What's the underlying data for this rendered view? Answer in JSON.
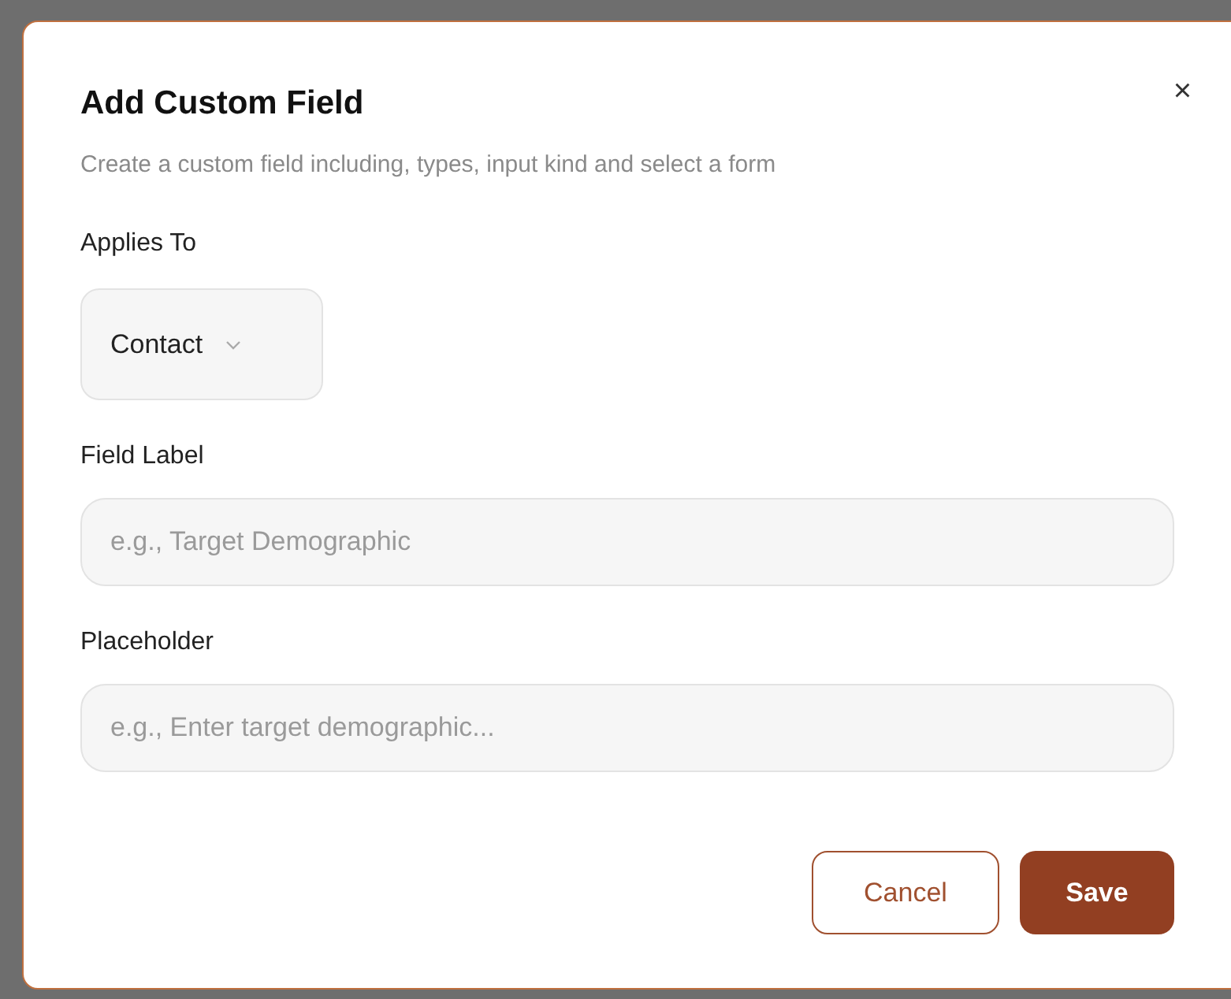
{
  "dialog": {
    "title": "Add Custom Field",
    "close": "×",
    "subtitle": "Create a custom field including, types, input kind and select a form"
  },
  "fields": [
    {
      "kind": "select",
      "label": "Applies To",
      "value": "Contact"
    },
    {
      "kind": "text",
      "label": "Field Label",
      "placeholder": "e.g., Target Demographic"
    },
    {
      "kind": "text",
      "label": "Placeholder",
      "placeholder": "e.g., Enter target demographic..."
    }
  ],
  "buttons": [
    {
      "label": "Cancel",
      "kind": "secondary"
    },
    {
      "label": "Save",
      "kind": "primary"
    }
  ]
}
